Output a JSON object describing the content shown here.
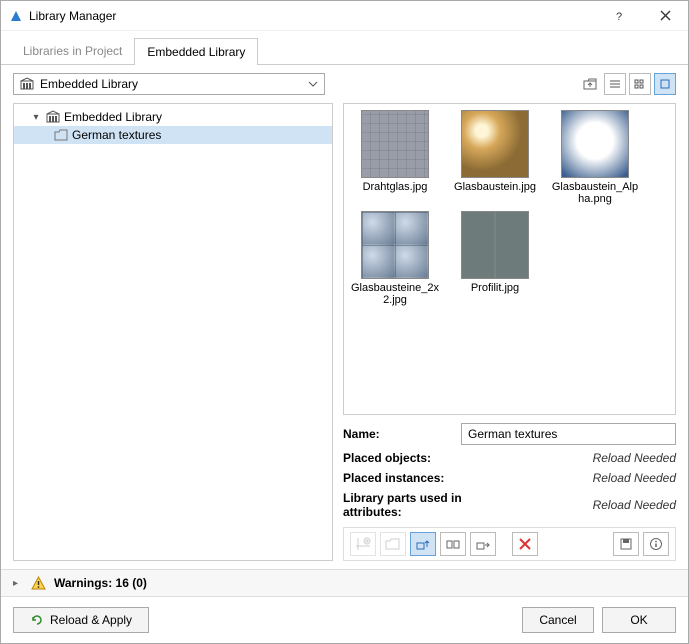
{
  "window": {
    "title": "Library Manager"
  },
  "tabs": {
    "libraries": "Libraries in Project",
    "embedded": "Embedded Library"
  },
  "selector": {
    "label": "Embedded Library"
  },
  "tree": {
    "root": "Embedded Library",
    "child": "German textures"
  },
  "thumbs": {
    "draht": "Drahtglas.jpg",
    "glas": "Glasbaustein.jpg",
    "glas_a": "Glasbaustein_Alpha.png",
    "glas2x2": "Glasbausteine_2x2.jpg",
    "profilit": "Profilit.jpg"
  },
  "info": {
    "name_label": "Name:",
    "name_value": "German textures",
    "placed_obj_label": "Placed objects:",
    "placed_inst_label": "Placed instances:",
    "libparts_label": "Library parts used in attributes:",
    "reload": "Reload Needed"
  },
  "warnings": {
    "text": "Warnings: 16 (0)"
  },
  "footer": {
    "reload": "Reload & Apply",
    "cancel": "Cancel",
    "ok": "OK"
  }
}
